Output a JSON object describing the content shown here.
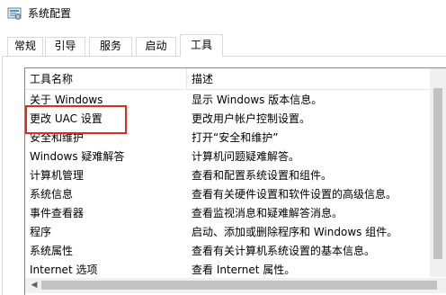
{
  "window": {
    "title": "系统配置",
    "app_icon": "msconfig-icon"
  },
  "tabs": [
    {
      "label": "常规"
    },
    {
      "label": "引导"
    },
    {
      "label": "服务"
    },
    {
      "label": "启动"
    },
    {
      "label": "工具",
      "active": true
    }
  ],
  "tools_list": {
    "columns": [
      "工具名称",
      "描述"
    ],
    "rows": [
      {
        "name": "关于 Windows",
        "desc": "显示 Windows 版本信息。"
      },
      {
        "name": "更改 UAC 设置",
        "desc": "更改用户帐户控制设置。",
        "highlighted": true
      },
      {
        "name": "安全和维护",
        "desc": "打开“安全和维护”"
      },
      {
        "name": "Windows 疑难解答",
        "desc": "计算机问题疑难解答。"
      },
      {
        "name": "计算机管理",
        "desc": "查看和配置系统设置和组件。"
      },
      {
        "name": "系统信息",
        "desc": "查看有关硬件设置和软件设置的高级信息。"
      },
      {
        "name": "事件查看器",
        "desc": "查看监视消息和疑难解答消息。"
      },
      {
        "name": "程序",
        "desc": "启动、添加或删除程序和 Windows 组件。"
      },
      {
        "name": "系统属性",
        "desc": "查看有关计算机系统设置的基本信息。"
      },
      {
        "name": "Internet 选项",
        "desc": "查看 Internet 属性。"
      }
    ]
  },
  "colors": {
    "highlight_border": "#e32a1c"
  }
}
